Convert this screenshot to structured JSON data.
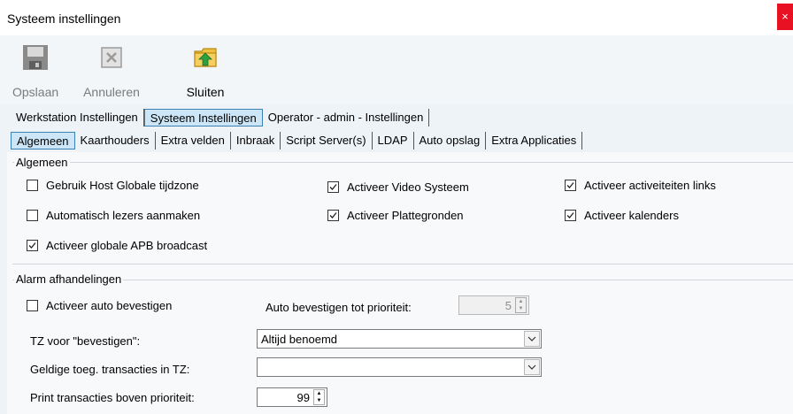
{
  "window": {
    "title": "Systeem instellingen",
    "close_glyph": "×"
  },
  "toolbar": {
    "save_label": "Opslaan",
    "cancel_label": "Annuleren",
    "close_label": "Sluiten"
  },
  "main_tabs": [
    "Werkstation Instellingen",
    "Systeem Instellingen",
    "Operator - admin - Instellingen"
  ],
  "sub_tabs": [
    "Algemeen",
    "Kaarthouders",
    "Extra velden",
    "Inbraak",
    "Script Server(s)",
    "LDAP",
    "Auto opslag",
    "Extra Applicaties"
  ],
  "general": {
    "legend": "Algemeen",
    "options": [
      {
        "label": "Gebruik Host Globale tijdzone",
        "checked": false
      },
      {
        "label": "Automatisch lezers aanmaken",
        "checked": false
      },
      {
        "label": "Activeer globale APB broadcast",
        "checked": true
      },
      {
        "label": "Activeer Video Systeem",
        "checked": true
      },
      {
        "label": "Activeer  Plattegronden",
        "checked": true
      },
      {
        "label": "Activeer activeiteiten links",
        "checked": true
      },
      {
        "label": "Activeer kalenders",
        "checked": true
      }
    ]
  },
  "alarm": {
    "legend": "Alarm afhandelingen",
    "auto_confirm": {
      "label": "Activeer auto bevestigen",
      "checked": false
    },
    "priority_label": "Auto bevestigen tot prioriteit:",
    "priority_value": "5",
    "tz_confirm_label": "TZ voor \"bevestigen\":",
    "tz_confirm_value": "Altijd benoemd",
    "valid_tx_label": "Geldige toeg. transacties in TZ:",
    "valid_tx_value": "",
    "print_label": "Print transacties boven prioriteit:",
    "print_value": "99"
  },
  "colors": {
    "active_tab_bg": "#cde6f7",
    "active_tab_border": "#3c7fb1",
    "close_red": "#e81123",
    "folder_yellow": "#f0c040",
    "arrow_green": "#2e9e3e"
  },
  "icons": {
    "save": "floppy-disk-icon",
    "cancel": "cancel-x-icon",
    "close": "folder-exit-icon"
  }
}
